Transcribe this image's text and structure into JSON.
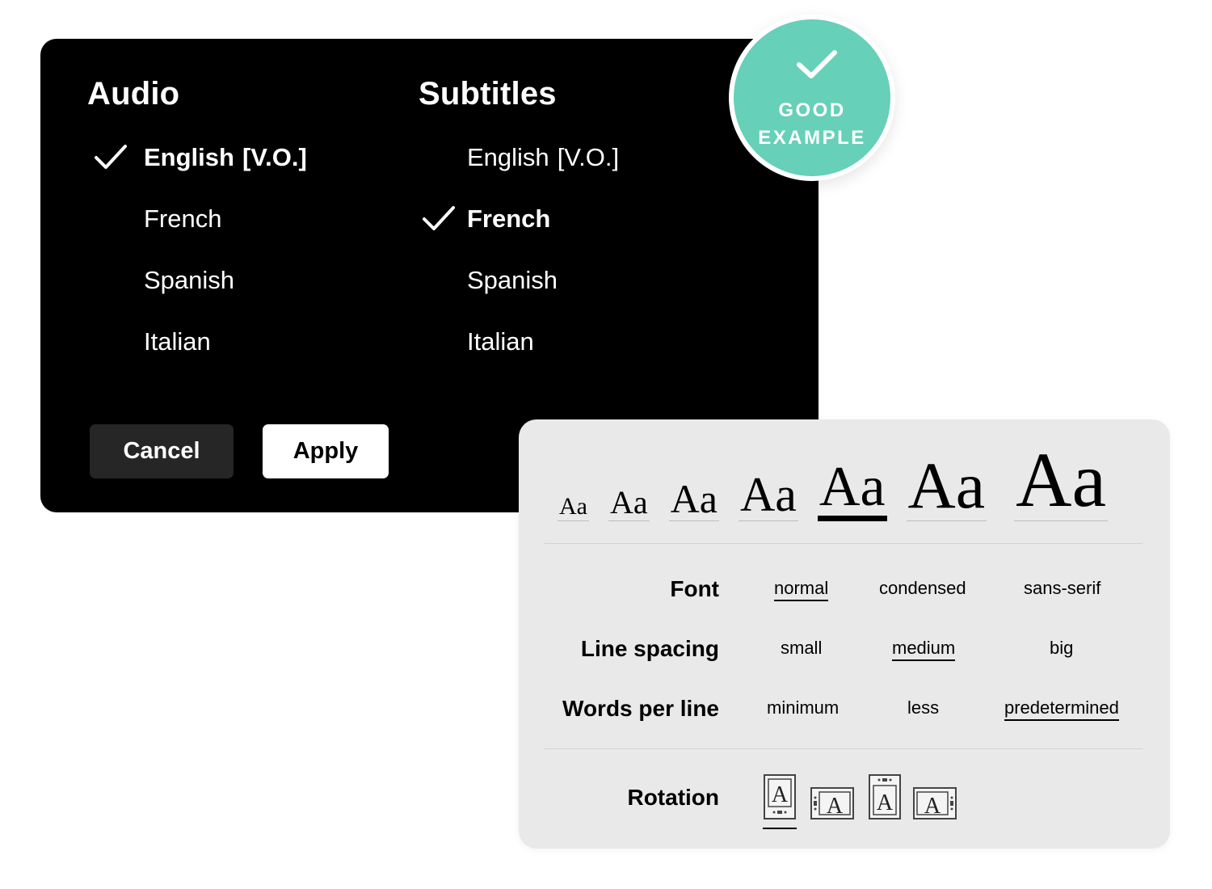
{
  "audio": {
    "title": "Audio",
    "items": [
      {
        "label": "English",
        "suffix": "[V.O.]",
        "selected": true
      },
      {
        "label": "French",
        "suffix": "",
        "selected": false
      },
      {
        "label": "Spanish",
        "suffix": "",
        "selected": false
      },
      {
        "label": "Italian",
        "suffix": "",
        "selected": false
      }
    ]
  },
  "subtitles": {
    "title": "Subtitles",
    "items": [
      {
        "label": "English",
        "suffix": "[V.O.]",
        "selected": false
      },
      {
        "label": "French",
        "suffix": "",
        "selected": true
      },
      {
        "label": "Spanish",
        "suffix": "",
        "selected": false
      },
      {
        "label": "Italian",
        "suffix": "",
        "selected": false
      }
    ]
  },
  "buttons": {
    "cancel": "Cancel",
    "apply": "Apply"
  },
  "badge": {
    "line1": "GOOD",
    "line2": "EXAMPLE",
    "icon": "check-icon",
    "color": "#66d0b8"
  },
  "text_size": {
    "sample": "Aa",
    "options": [
      "Aa",
      "Aa",
      "Aa",
      "Aa",
      "Aa",
      "Aa",
      "Aa"
    ],
    "selected_index": 4
  },
  "settings": {
    "font": {
      "label": "Font",
      "options": [
        "normal",
        "condensed",
        "sans-serif"
      ],
      "selected": "normal"
    },
    "line_spacing": {
      "label": "Line spacing",
      "options": [
        "small",
        "medium",
        "big"
      ],
      "selected": "medium"
    },
    "words_per_line": {
      "label": "Words per line",
      "options": [
        "minimum",
        "less",
        "predetermined"
      ],
      "selected": "predetermined"
    },
    "rotation": {
      "label": "Rotation",
      "icons": [
        "rotation-portrait-icon",
        "rotation-landscape-left-icon",
        "rotation-portrait-flipped-icon",
        "rotation-landscape-right-icon"
      ],
      "selected_index": 0
    }
  }
}
